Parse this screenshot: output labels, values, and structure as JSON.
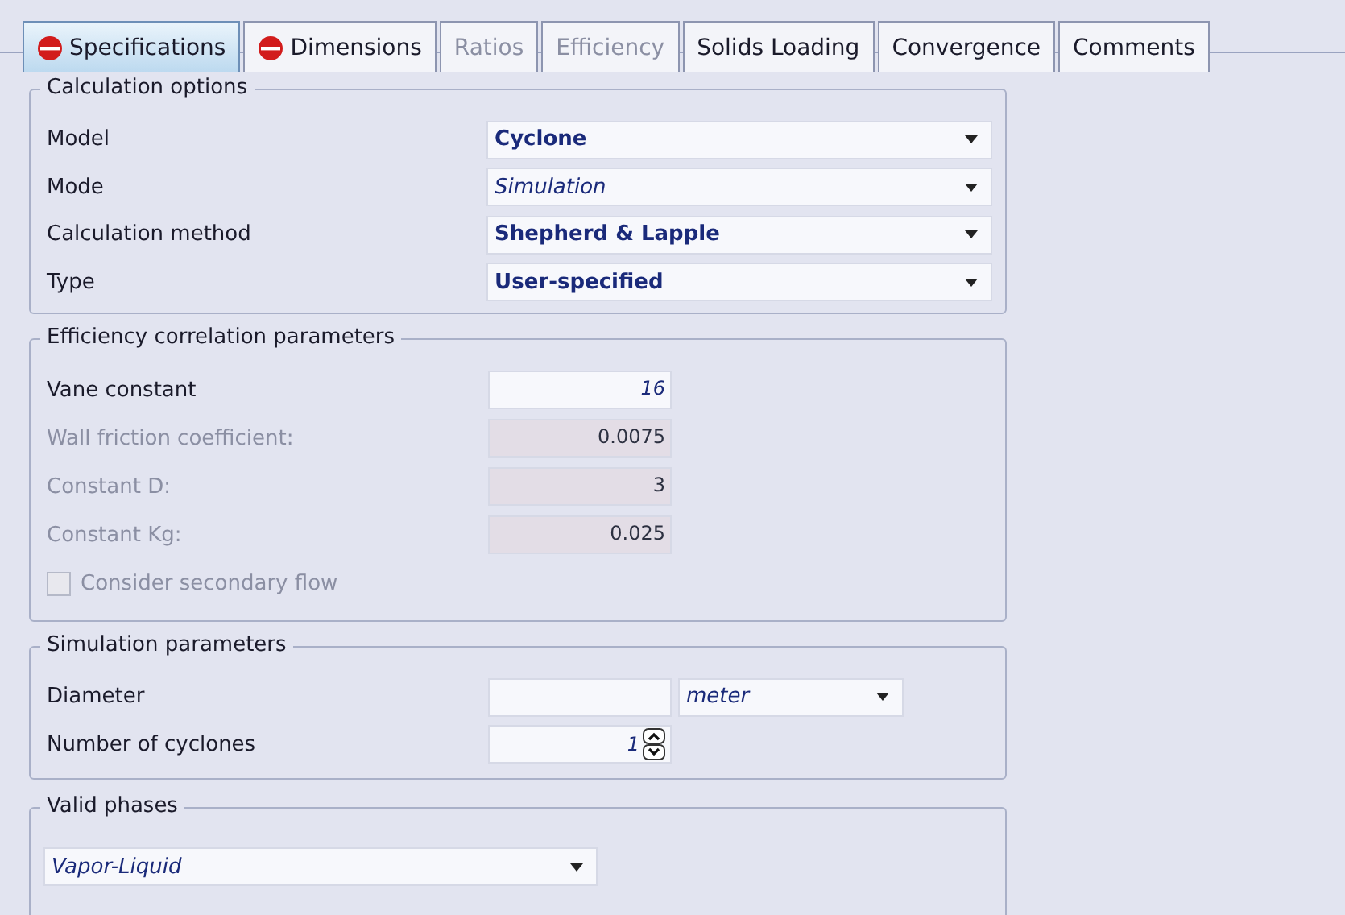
{
  "tabs": [
    {
      "label": "Specifications",
      "selected": true,
      "disabled": false,
      "incomplete": true
    },
    {
      "label": "Dimensions",
      "selected": false,
      "disabled": false,
      "incomplete": true
    },
    {
      "label": "Ratios",
      "selected": false,
      "disabled": true,
      "incomplete": false
    },
    {
      "label": "Efficiency",
      "selected": false,
      "disabled": true,
      "incomplete": false
    },
    {
      "label": "Solids Loading",
      "selected": false,
      "disabled": false,
      "incomplete": false
    },
    {
      "label": "Convergence",
      "selected": false,
      "disabled": false,
      "incomplete": false
    },
    {
      "label": "Comments",
      "selected": false,
      "disabled": false,
      "incomplete": false
    }
  ],
  "calculation_options": {
    "title": "Calculation options",
    "rows": [
      {
        "label": "Model",
        "value": "Cyclone",
        "kind": "specified"
      },
      {
        "label": "Mode",
        "value": "Simulation",
        "kind": "default"
      },
      {
        "label": "Calculation method",
        "value": "Shepherd & Lapple",
        "kind": "specified"
      },
      {
        "label": "Type",
        "value": "User-specified",
        "kind": "specified"
      }
    ]
  },
  "efficiency_correlation": {
    "title": "Efficiency correlation parameters",
    "rows": [
      {
        "label": "Vane constant",
        "value": "16",
        "disabled": false
      },
      {
        "label": "Wall friction coefficient:",
        "value": "0.0075",
        "disabled": true
      },
      {
        "label": "Constant D:",
        "value": "3",
        "disabled": true
      },
      {
        "label": "Constant Kg:",
        "value": "0.025",
        "disabled": true
      }
    ],
    "checkbox": {
      "label": "Consider secondary flow",
      "checked": false,
      "disabled": true
    }
  },
  "simulation_parameters": {
    "title": "Simulation parameters",
    "diameter": {
      "label": "Diameter",
      "unit": "meter"
    },
    "cyclones": {
      "label": "Number of cyclones",
      "value": "1"
    }
  },
  "valid_phases": {
    "title": "Valid phases",
    "value": "Vapor-Liquid"
  }
}
